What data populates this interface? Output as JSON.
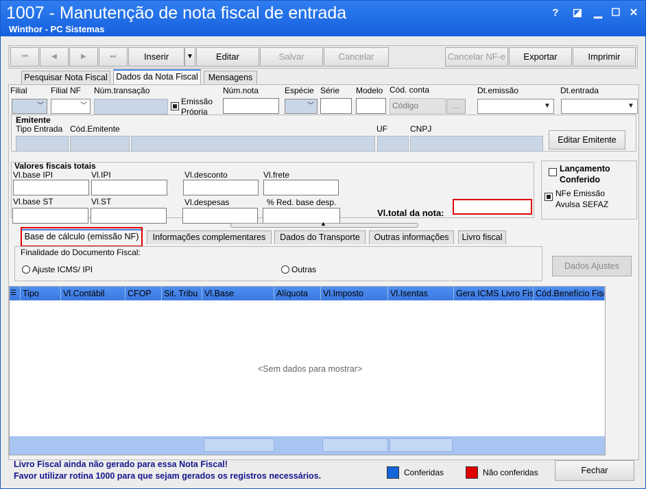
{
  "window": {
    "title": "1007 - Manutenção de nota fiscal de entrada",
    "subtitle": "Winthor - PC Sistemas",
    "controls": [
      "?",
      "◪",
      "▁",
      "☐",
      "✕"
    ]
  },
  "toolbar": {
    "nav_first": "⏮",
    "nav_prev": "◀",
    "nav_next": "▶",
    "nav_last": "⏭",
    "insert": "Inserir",
    "edit": "Editar",
    "save": "Salvar",
    "cancel": "Cancelar",
    "cancel_nfe": "Cancelar NF-e",
    "export": "Exportar",
    "print": "Imprimir"
  },
  "main_tabs": [
    "Pesquisar Nota Fiscal",
    "Dados da Nota Fiscal",
    "Mensagens"
  ],
  "header_fields": {
    "filial": "Filial",
    "filial_nf": "Filial NF",
    "num_transacao": "Núm.transação",
    "emissao_propria": "Emissão Própria",
    "emissao_propria_line1": "Emissão",
    "emissao_propria_line2": "Própria",
    "num_nota": "Núm.nota",
    "especie": "Espécie",
    "serie": "Série",
    "modelo": "Modelo",
    "cod_conta": "Cód. conta",
    "cod_conta_placeholder": "Código",
    "lookup_button": "...",
    "dt_emissao": "Dt.emissão",
    "dt_entrada": "Dt.entrada"
  },
  "emitente": {
    "title": "Emitente",
    "tipo_entrada": "Tipo Entrada",
    "cod_emitente": "Cód.Emitente",
    "uf": "UF",
    "cnpj": "CNPJ",
    "edit_button": "Editar Emitente"
  },
  "totais": {
    "title": "Valores fiscais totais",
    "vl_base_ipi": "Vl.base IPI",
    "vl_ipi": "Vl.IPI",
    "vl_desconto": "Vl.desconto",
    "vl_frete": "Vl.frete",
    "vl_base_st": "Vl.base ST",
    "vl_st": "Vl.ST",
    "vl_despesas": "Vl.despesas",
    "red_base_desp": "% Red. base desp.",
    "vl_total_nota": "Vl.total da nota:"
  },
  "side_options": {
    "lancamento_conferido": "Lançamento Conferido",
    "lancamento_line1": "Lançamento",
    "lancamento_line2": "Conferido",
    "nfe_emissao": "NFe Emissão Avulsa SEFAZ",
    "nfe_line1": "NFe Emissão",
    "nfe_line2": "Avulsa SEFAZ"
  },
  "sub_tabs": [
    "Base de cálculo (emissão NF)",
    "Informações complementares",
    "Dados do Transporte",
    "Outras informações",
    "Livro fiscal"
  ],
  "finalidade": {
    "title": "Finalidade do Documento Fiscal:",
    "option1": "Ajuste ICMS/ IPI",
    "option2": "Outras",
    "dados_ajustes": "Dados Ajustes"
  },
  "grid": {
    "columns": [
      "Tipo",
      "Vl.Contábil",
      "CFOP",
      "Sit. Tribu",
      "Vl.Base",
      "Alíquota",
      "Vl.Imposto",
      "Vl.Isentas",
      "Gera ICMS Livro Fis",
      "Cód.Benefício Fisc"
    ],
    "empty_text": "<Sem dados para mostrar>"
  },
  "footer": {
    "msg1": "Livro Fiscal ainda não gerado para essa Nota Fiscal!",
    "msg2": "Favor utilizar rotina 1000 para que sejam gerados os registros necessários.",
    "legend_conferidas": "Conferidas",
    "legend_nao_conferidas": "Não conferidas",
    "close_button": "Fechar"
  },
  "colors": {
    "conferidas": "#1565d8",
    "nao_conferidas": "#e00000",
    "highlight": "#e00000"
  }
}
